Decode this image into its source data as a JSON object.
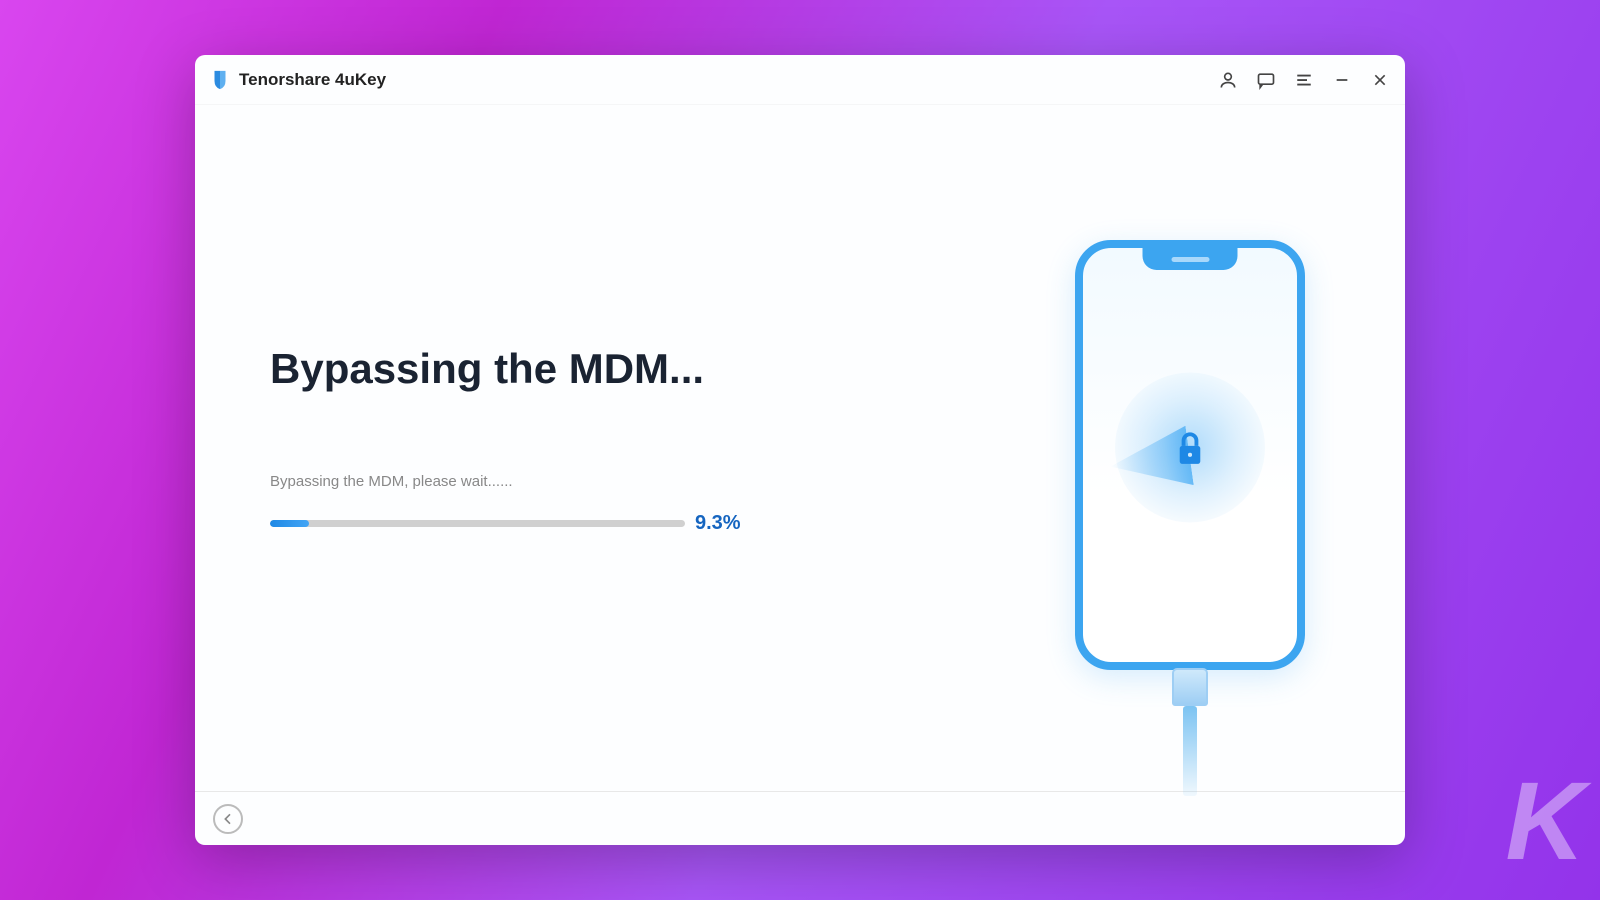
{
  "app": {
    "title": "Tenorshare 4uKey"
  },
  "titlebar": {
    "account_icon": "user-icon",
    "feedback_icon": "chat-icon",
    "menu_icon": "menu-icon",
    "minimize_icon": "minimize-icon",
    "close_icon": "close-icon"
  },
  "main": {
    "heading": "Bypassing the MDM...",
    "status_text": "Bypassing the MDM, please wait......",
    "progress_percent": 9.3,
    "progress_label": "9.3%"
  },
  "illustration": {
    "device": "iphone",
    "icon": "lock-icon"
  },
  "footer": {
    "back_icon": "arrow-left-icon"
  },
  "watermark": "K",
  "colors": {
    "accent": "#1e88e5",
    "progress_text": "#1565c0",
    "phone_border": "#3ca5f0"
  }
}
